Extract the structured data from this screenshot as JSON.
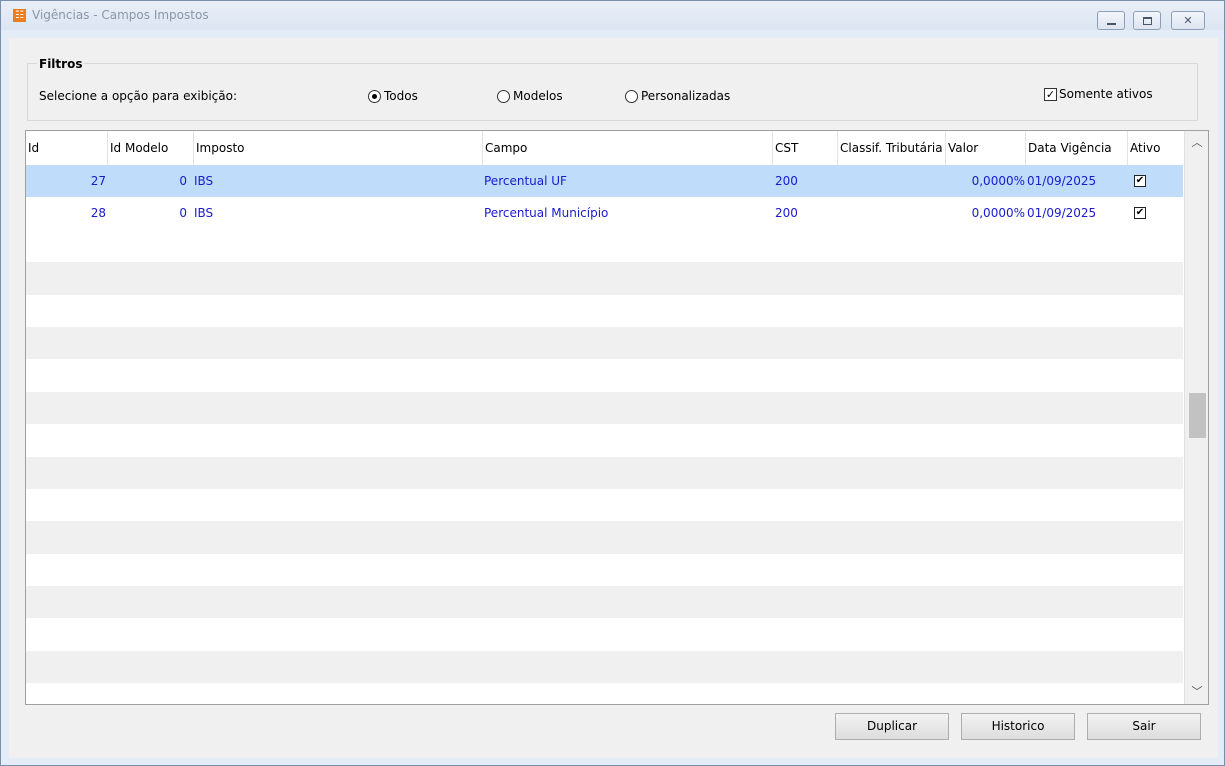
{
  "window": {
    "title": "Vigências - Campos Impostos",
    "app_icon": "orange-app-icon"
  },
  "filters": {
    "legend": "Filtros",
    "prompt": "Selecione a opção para exibição:",
    "options": [
      {
        "label": "Todos",
        "selected": true
      },
      {
        "label": "Modelos",
        "selected": false
      },
      {
        "label": "Personalizadas",
        "selected": false
      }
    ],
    "only_active_label": "Somente ativos",
    "only_active_checked": true
  },
  "grid": {
    "columns": [
      "Id",
      "Id Modelo",
      "Imposto",
      "Campo",
      "CST",
      "Classif. Tributária",
      "Valor",
      "Data Vigência",
      "Ativo"
    ],
    "rows": [
      {
        "id": "27",
        "id_modelo": "0",
        "imposto": "IBS",
        "campo": "Percentual UF",
        "cst": "200",
        "classif": "",
        "valor": "0,0000%",
        "data": "01/09/2025",
        "ativo": true,
        "selected": true
      },
      {
        "id": "28",
        "id_modelo": "0",
        "imposto": "IBS",
        "campo": "Percentual Município",
        "cst": "200",
        "classif": "",
        "valor": "0,0000%",
        "data": "01/09/2025",
        "ativo": true,
        "selected": false
      }
    ]
  },
  "buttons": {
    "duplicar": "Duplicar",
    "historico": "Historico",
    "sair": "Sair"
  },
  "colors": {
    "row_text": "#1a1ad0",
    "selected_row": "#bfdcfa",
    "alt_row": "#f0f0f0"
  }
}
